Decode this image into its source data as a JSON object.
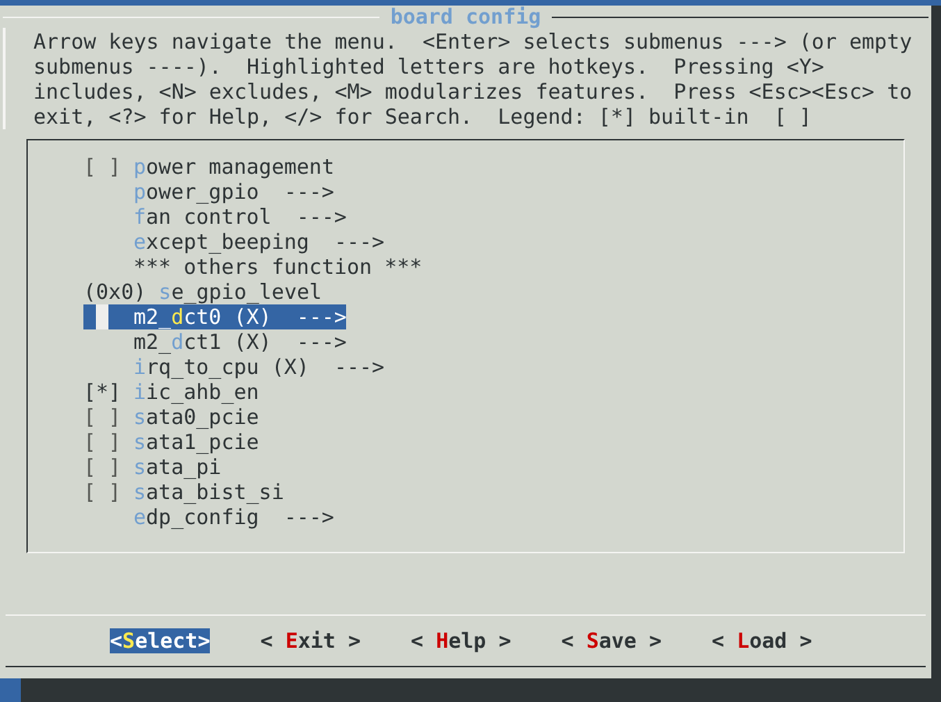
{
  "dialog": {
    "title": "board config",
    "help_text": [
      "Arrow keys navigate the menu.  <Enter> selects submenus ---> (or empty",
      "submenus ----).  Highlighted letters are hotkeys.  Pressing <Y>",
      "includes, <N> excludes, <M> modularizes features.  Press <Esc><Esc> to",
      "exit, <?> for Help, </> for Search.  Legend: [*] built-in  [ ]"
    ]
  },
  "menu": {
    "items": [
      {
        "kind": "bool",
        "checked": false,
        "prefix": "[ ]",
        "hotkey": "p",
        "after": "ower management",
        "selected": false
      },
      {
        "kind": "menu",
        "hotkey": "p",
        "after": "ower_gpio",
        "arrow": "--->",
        "selected": false
      },
      {
        "kind": "menu",
        "hotkey": "f",
        "after": "an control",
        "arrow": "--->",
        "selected": false
      },
      {
        "kind": "menu",
        "hotkey": "e",
        "after": "xcept_beeping",
        "arrow": "--->",
        "selected": false
      },
      {
        "kind": "comment",
        "text": "*** others function ***",
        "selected": false
      },
      {
        "kind": "value",
        "prefix": "(0x0)",
        "hotkey": "s",
        "after": "e_gpio_level",
        "selected": false
      },
      {
        "kind": "menu",
        "before": "m2_",
        "hotkey": "d",
        "after": "ct0 (X)",
        "arrow": "--->",
        "selected": true
      },
      {
        "kind": "menu",
        "before": "m2_",
        "hotkey": "d",
        "after": "ct1 (X)",
        "arrow": "--->",
        "selected": false
      },
      {
        "kind": "menu",
        "hotkey": "i",
        "after": "rq_to_cpu (X)",
        "arrow": "--->",
        "selected": false
      },
      {
        "kind": "bool",
        "checked": true,
        "prefix": "[*]",
        "hotkey": "i",
        "after": "ic_ahb_en",
        "selected": false
      },
      {
        "kind": "bool",
        "checked": false,
        "prefix": "[ ]",
        "hotkey": "s",
        "after": "ata0_pcie",
        "selected": false
      },
      {
        "kind": "bool",
        "checked": false,
        "prefix": "[ ]",
        "hotkey": "s",
        "after": "ata1_pcie",
        "selected": false
      },
      {
        "kind": "bool",
        "checked": false,
        "prefix": "[ ]",
        "hotkey": "s",
        "after": "ata_pi",
        "selected": false
      },
      {
        "kind": "bool",
        "checked": false,
        "prefix": "[ ]",
        "hotkey": "s",
        "after": "ata_bist_si",
        "selected": false
      },
      {
        "kind": "menu",
        "hotkey": "e",
        "after": "dp_config",
        "arrow": "--->",
        "selected": false
      }
    ]
  },
  "buttons": [
    {
      "left": "<",
      "hotkey": "S",
      "rest": "elect",
      "right": ">",
      "selected": true
    },
    {
      "left": "< ",
      "hotkey": "E",
      "rest": "xit",
      "right": " >",
      "selected": false
    },
    {
      "left": "< ",
      "hotkey": "H",
      "rest": "elp",
      "right": " >",
      "selected": false
    },
    {
      "left": "< ",
      "hotkey": "S",
      "rest": "ave",
      "right": " >",
      "selected": false
    },
    {
      "left": "< ",
      "hotkey": "L",
      "rest": "oad",
      "right": " >",
      "selected": false
    }
  ]
}
